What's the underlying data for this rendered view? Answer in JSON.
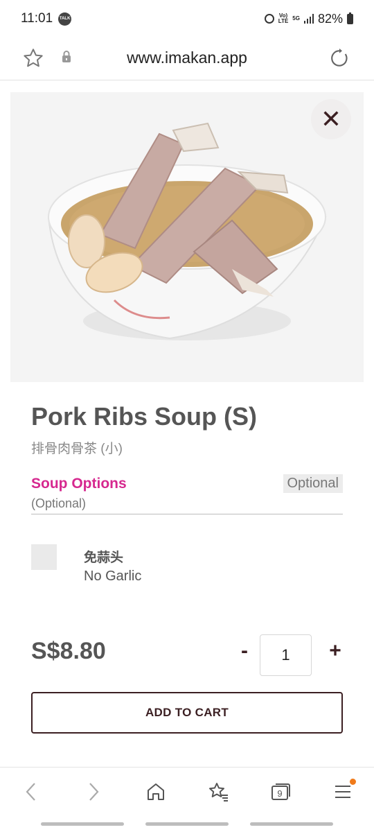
{
  "status_bar": {
    "time": "11:01",
    "talk_badge": "TALK",
    "network_top": "Vo)",
    "network_bottom": "LTE",
    "network_5g": "5G",
    "battery": "82%"
  },
  "url_bar": {
    "url": "www.imakan.app"
  },
  "item": {
    "title": "Pork Ribs Soup (S)",
    "subtitle": "排骨肉骨茶 (小)",
    "close_icon": "close-icon"
  },
  "options_section": {
    "title": "Soup Options",
    "subtitle": "(Optional)",
    "badge": "Optional",
    "accent_color": "#d6288f",
    "options": [
      {
        "label_zh": "免蒜头",
        "label_en": "No Garlic",
        "checked": false
      }
    ]
  },
  "purchase": {
    "price": "S$8.80",
    "minus": "-",
    "quantity": "1",
    "plus": "+",
    "add_to_cart": "ADD TO CART",
    "button_color": "#3b1f22"
  },
  "bottom_nav": {
    "tabs_count": "9",
    "icons": [
      "back-icon",
      "forward-icon",
      "home-icon",
      "bookmarks-icon",
      "tabs-icon",
      "menu-icon"
    ]
  }
}
